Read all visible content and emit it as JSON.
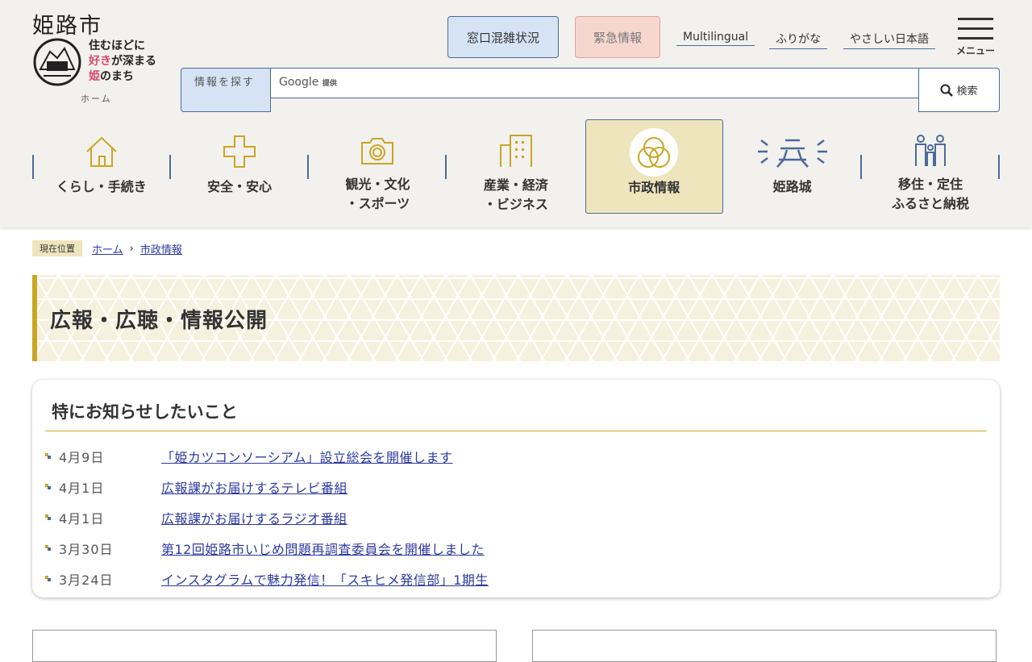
{
  "header": {
    "city": "姫路市",
    "slogan": [
      "住むほどに",
      "好き",
      "が深まる",
      "姫",
      "のまち"
    ],
    "home": "ホーム",
    "madoguchi": "窓口混雑状況",
    "kinkyu": "緊急情報",
    "links": [
      "Multilingual",
      "ふりがな",
      "やさしい日本語"
    ],
    "menu": "メニュー",
    "search_label": "情報を探す",
    "search_brand": "Google",
    "search_provided": "提供",
    "search_button": "検索"
  },
  "nav": [
    {
      "label": "くらし・手続き",
      "icon": "house-icon"
    },
    {
      "label": "安全・安心",
      "icon": "cross-icon"
    },
    {
      "label": "観光・文化\n・スポーツ",
      "icon": "camera-icon"
    },
    {
      "label": "産業・経済\n・ビジネス",
      "icon": "building-icon"
    },
    {
      "label": "市政情報",
      "icon": "city-emblem-icon"
    },
    {
      "label": "姫路城",
      "icon": "castle-icon"
    },
    {
      "label": "移住・定住\nふるさと納税",
      "icon": "family-icon"
    }
  ],
  "breadcrumb": {
    "current": "現在位置",
    "items": [
      "ホーム",
      "市政情報"
    ]
  },
  "page_title": "広報・広聴・情報公開",
  "notice": {
    "title": "特にお知らせしたいこと",
    "items": [
      {
        "date": "4月9日",
        "title": "「姫カツコンソーシアム」設立総会を開催します"
      },
      {
        "date": "4月1日",
        "title": "広報課がお届けするテレビ番組"
      },
      {
        "date": "4月1日",
        "title": "広報課がお届けするラジオ番組"
      },
      {
        "date": "3月30日",
        "title": "第12回姫路市いじめ問題再調査委員会を開催しました"
      },
      {
        "date": "3月24日",
        "title": "インスタグラムで魅力発信！「スキヒメ発信部」1期生"
      }
    ]
  },
  "colors": {
    "gold": "#c9a625",
    "blue": "#4b6a9a",
    "link": "#2d3a9e"
  }
}
